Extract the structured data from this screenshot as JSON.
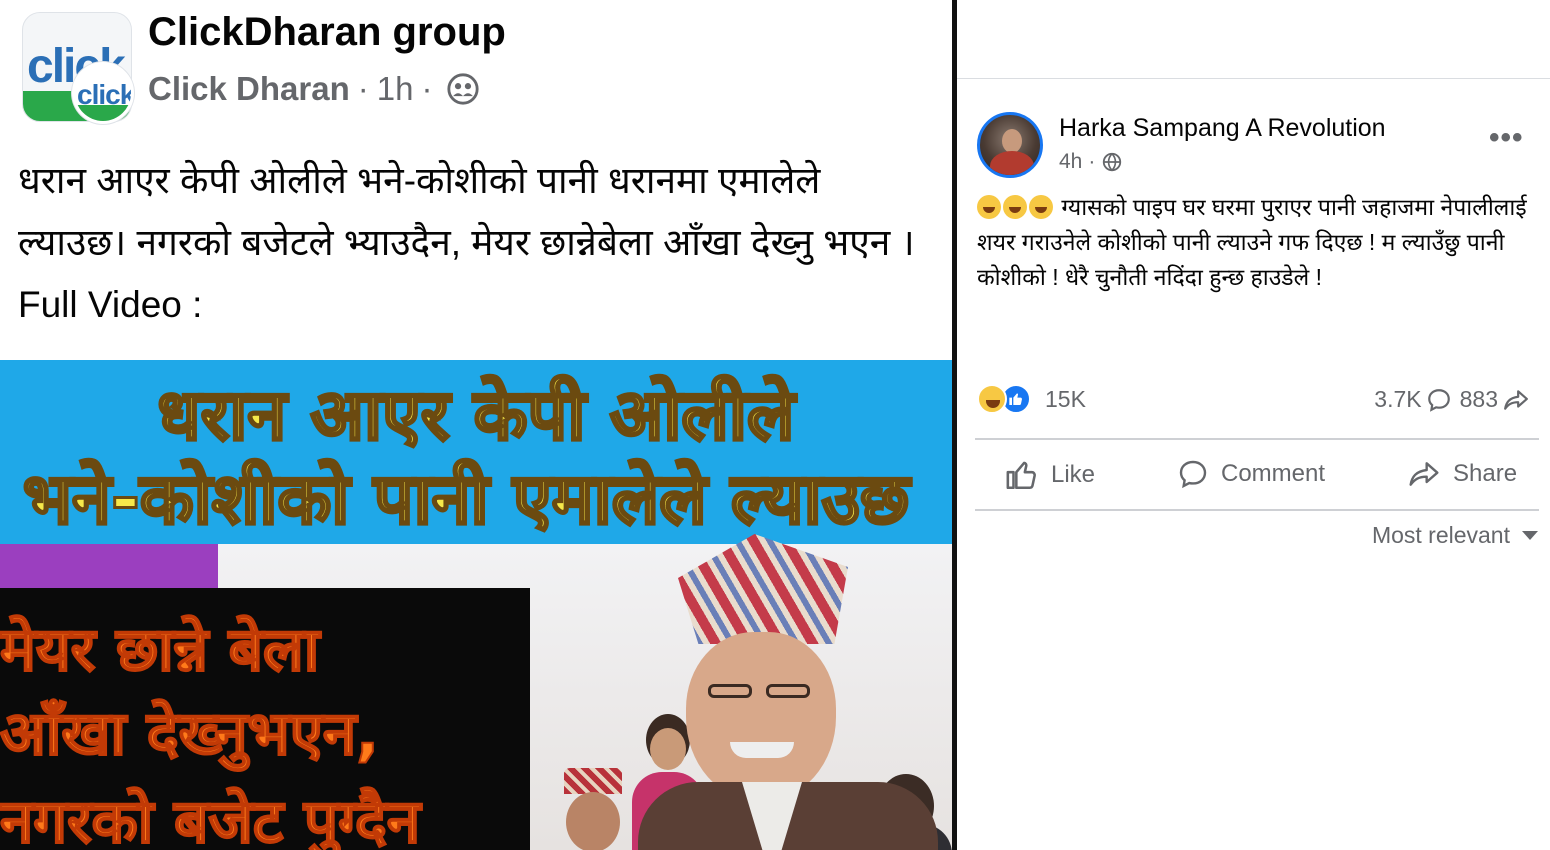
{
  "left_post": {
    "group_name": "ClickDharan group",
    "author": "Click Dharan",
    "time": "1h",
    "separator": "·",
    "logo_text": "click",
    "post_text": "धरान आएर केपी ओलीले भने-कोशीको पानी धरानमा एमालेले ल्याउछ। नगरको बजेटले भ्याउदैन, मेयर छान्नेबेला आँखा देख्नु भएन । Full Video :",
    "thumbnail": {
      "banner_line_1": "धरान आएर केपी ओलीले",
      "banner_line_2": "भने-कोशीको पानी एमालेले ल्याउछ",
      "box_line_1": "मेयर छान्ने बेला",
      "box_line_2": "आँखा देख्नुभएन,",
      "box_line_3": "नगरको बजेट पुग्दैन"
    }
  },
  "right_post": {
    "page_name": "Harka Sampang A Revolution",
    "time": "4h",
    "separator": "·",
    "more_label": "•••",
    "post_text": "ग्यासको पाइप घर घरमा पुराएर पानी जहाजमा नेपालीलाई शयर गराउनेले कोशीको पानी ल्याउने गफ दिएछ ! म ल्याउँछु पानी कोशीको ! धेरै चुनौती नदिंदा हुन्छ हाउडेले !",
    "reaction_count": "15K",
    "comment_count": "3.7K",
    "share_count": "883",
    "actions": {
      "like": "Like",
      "comment": "Comment",
      "share": "Share"
    },
    "sort_label": "Most relevant"
  },
  "colors": {
    "facebook_blue": "#1877f2",
    "meta_gray": "#65676b",
    "banner_blue": "#1fa8e8",
    "banner_yellow": "#f6e94a",
    "box_orange": "#ff7a1a",
    "logo_green": "#2aa84a"
  },
  "icons": {
    "members": "members-icon",
    "globe": "globe-icon",
    "like": "thumbs-up-icon",
    "comment": "comment-bubble-icon",
    "share": "share-arrow-icon",
    "reaction_haha": "haha-reaction-icon",
    "reaction_like": "like-reaction-icon",
    "sort": "caret-down-icon"
  }
}
